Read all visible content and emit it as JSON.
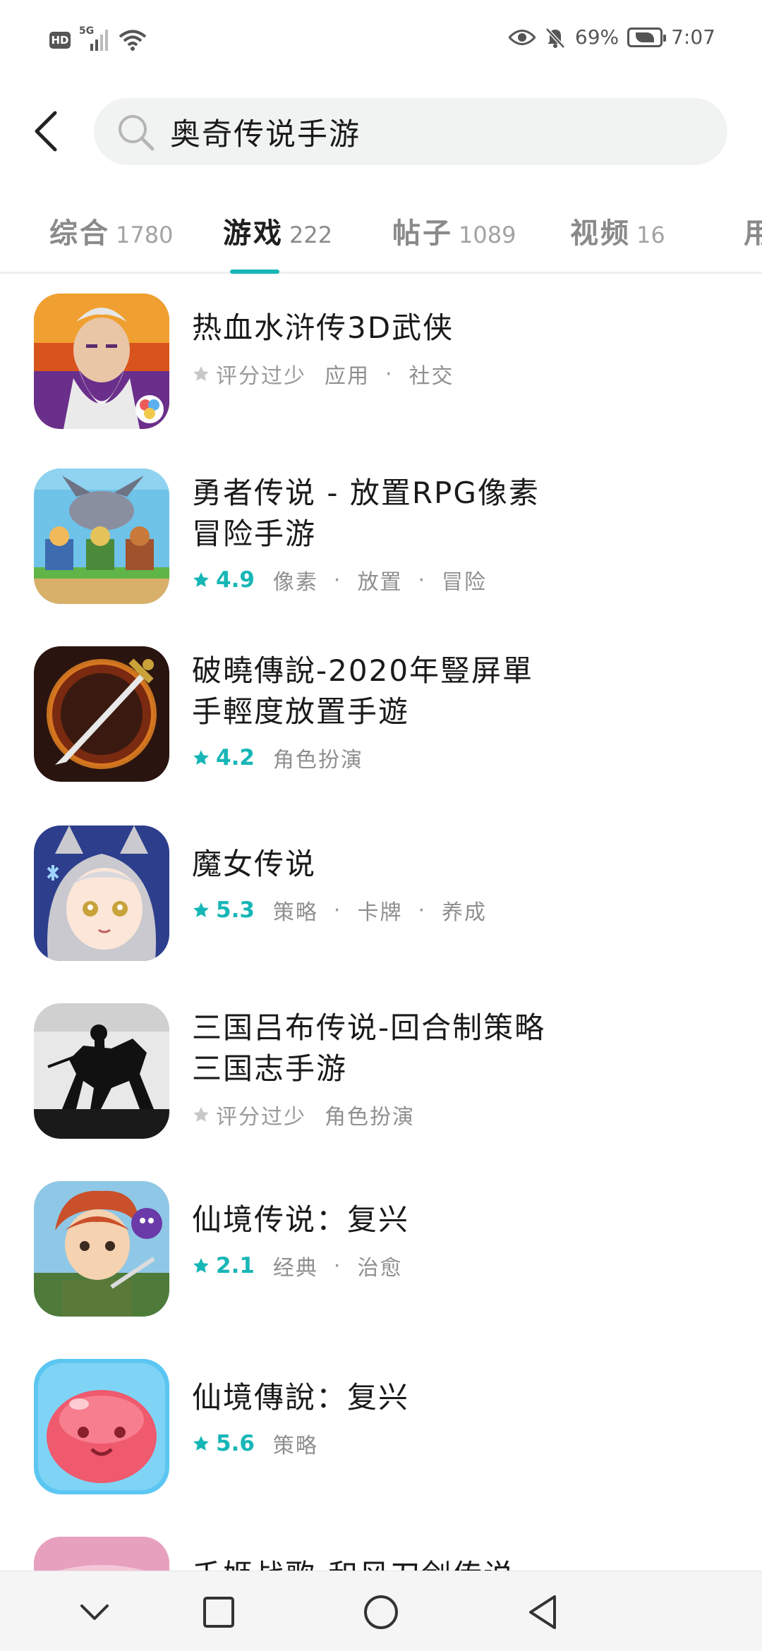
{
  "status_bar": {
    "hd": "HD",
    "network": "5G",
    "battery_percent": "69%",
    "time": "7:07"
  },
  "search": {
    "query": "奥奇传说手游"
  },
  "tabs": [
    {
      "label": "综合",
      "count": "1780",
      "active": false
    },
    {
      "label": "游戏",
      "count": "222",
      "active": true
    },
    {
      "label": "帖子",
      "count": "1089",
      "active": false
    },
    {
      "label": "视频",
      "count": "16",
      "active": false
    },
    {
      "label": "用",
      "count": "",
      "active": false
    }
  ],
  "results": [
    {
      "title": "热血水浒传3D武侠",
      "rating": "",
      "rating_text": "评分过少",
      "tags": [
        "应用",
        "社交"
      ]
    },
    {
      "title": "勇者传说 - 放置RPG像素冒险手游",
      "rating": "4.9",
      "rating_text": "",
      "tags": [
        "像素",
        "放置",
        "冒险"
      ]
    },
    {
      "title": "破曉傳說-2020年豎屏單手輕度放置手遊",
      "rating": "4.2",
      "rating_text": "",
      "tags": [
        "角色扮演"
      ]
    },
    {
      "title": "魔女传说",
      "rating": "5.3",
      "rating_text": "",
      "tags": [
        "策略",
        "卡牌",
        "养成"
      ]
    },
    {
      "title": "三国吕布传说-回合制策略三国志手游",
      "rating": "",
      "rating_text": "评分过少",
      "tags": [
        "角色扮演"
      ]
    },
    {
      "title": "仙境传说：复兴",
      "rating": "2.1",
      "rating_text": "",
      "tags": [
        "经典",
        "治愈"
      ]
    },
    {
      "title": "仙境傳說：复兴",
      "rating": "5.6",
      "rating_text": "",
      "tags": [
        "策略"
      ]
    },
    {
      "title": "千姬战歌-和风刀剑传说",
      "rating": "",
      "rating_text": "",
      "tags": []
    }
  ],
  "colors": {
    "accent": "#17b6b6",
    "search_bg": "#f1f3f3"
  },
  "icons": {
    "back": "chevron-left-icon",
    "search": "search-icon",
    "nav_back": "triangle-back-icon",
    "nav_home": "circle-home-icon",
    "nav_recents": "square-recents-icon",
    "nav_hide": "chevron-down-icon"
  }
}
